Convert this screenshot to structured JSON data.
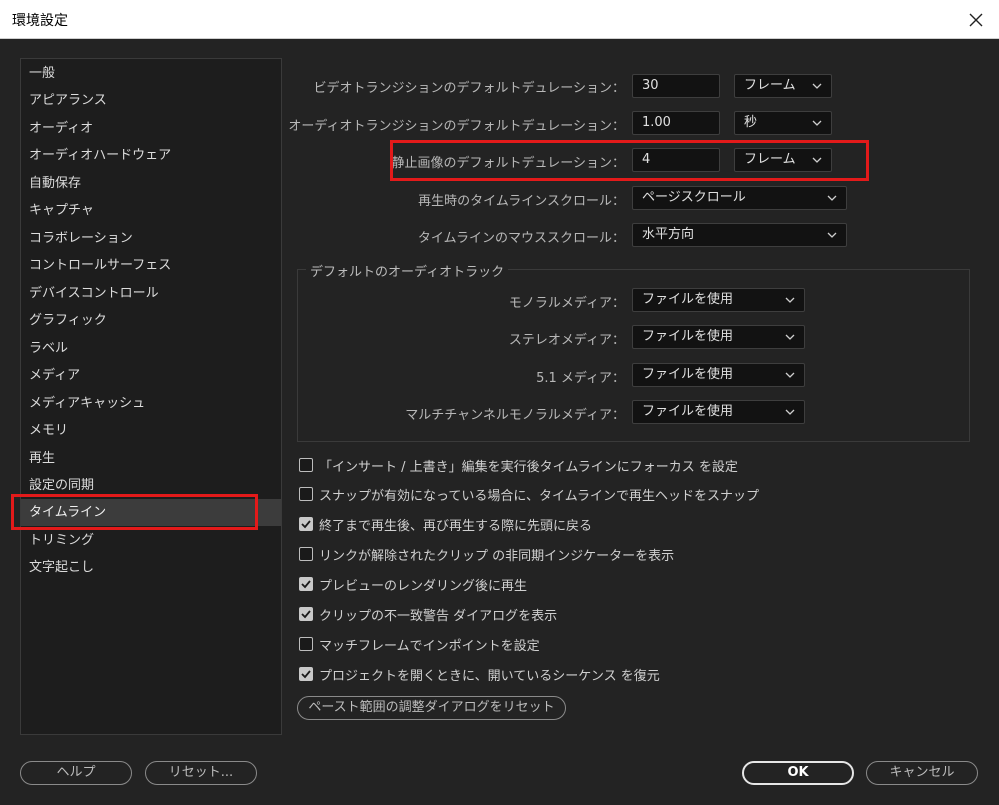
{
  "window": {
    "title": "環境設定"
  },
  "sidebar": {
    "items": [
      {
        "label": "一般"
      },
      {
        "label": "アピアランス"
      },
      {
        "label": "オーディオ"
      },
      {
        "label": "オーディオハードウェア"
      },
      {
        "label": "自動保存"
      },
      {
        "label": "キャプチャ"
      },
      {
        "label": "コラボレーション"
      },
      {
        "label": "コントロールサーフェス"
      },
      {
        "label": "デバイスコントロール"
      },
      {
        "label": "グラフィック"
      },
      {
        "label": "ラベル"
      },
      {
        "label": "メディア"
      },
      {
        "label": "メディアキャッシュ"
      },
      {
        "label": "メモリ"
      },
      {
        "label": "再生"
      },
      {
        "label": "設定の同期"
      },
      {
        "label": "タイムライン",
        "selected": true
      },
      {
        "label": "トリミング"
      },
      {
        "label": "文字起こし"
      }
    ]
  },
  "settings": {
    "video_transition": {
      "label": "ビデオトランジションのデフォルトデュレーション：",
      "value": "30",
      "unit": "フレーム"
    },
    "audio_transition": {
      "label": "オーディオトランジションのデフォルトデュレーション：",
      "value": "1.00",
      "unit": "秒"
    },
    "still_image": {
      "label": "静止画像のデフォルトデュレーション：",
      "value": "4",
      "unit": "フレーム"
    },
    "playback_scroll": {
      "label": "再生時のタイムラインスクロール：",
      "value": "ページスクロール"
    },
    "mouse_scroll": {
      "label": "タイムラインのマウススクロール：",
      "value": "水平方向"
    }
  },
  "audio_tracks": {
    "title": "デフォルトのオーディオトラック",
    "mono": {
      "label": "モノラルメディア：",
      "value": "ファイルを使用"
    },
    "stereo": {
      "label": "ステレオメディア：",
      "value": "ファイルを使用"
    },
    "surround": {
      "label": "5.1 メディア：",
      "value": "ファイルを使用"
    },
    "multichannel": {
      "label": "マルチチャンネルモノラルメディア：",
      "value": "ファイルを使用"
    }
  },
  "checkboxes": [
    {
      "label": "「インサート / 上書き」編集を実行後タイムラインにフォーカス を設定",
      "checked": false
    },
    {
      "label": "スナップが有効になっている場合に、タイムラインで再生ヘッドをスナップ",
      "checked": false
    },
    {
      "label": "終了まで再生後、再び再生する際に先頭に戻る",
      "checked": true
    },
    {
      "label": "リンクが解除されたクリップ の非同期インジケーターを表示",
      "checked": false
    },
    {
      "label": "プレビューのレンダリング後に再生",
      "checked": true
    },
    {
      "label": "クリップの不一致警告 ダイアログを表示",
      "checked": true
    },
    {
      "label": "マッチフレームでインポイントを設定",
      "checked": false
    },
    {
      "label": "プロジェクトを開くときに、開いているシーケンス を復元",
      "checked": true
    }
  ],
  "paste_range_button": "ペースト範囲の調整ダイアログをリセット",
  "footer": {
    "help": "ヘルプ",
    "reset": "リセット...",
    "ok": "OK",
    "cancel": "キャンセル"
  },
  "colors": {
    "highlight": "#e31a1a",
    "background": "#232323"
  }
}
